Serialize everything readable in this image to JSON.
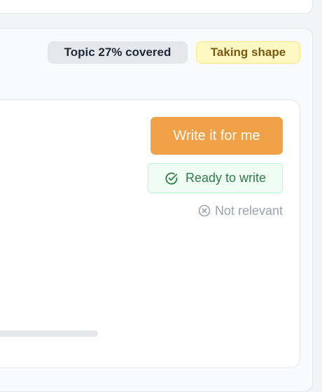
{
  "top_card": {},
  "panel": {
    "coverage_badge": "Topic 27% covered",
    "status_badge": "Taking shape"
  },
  "card": {
    "write_button_label": "Write it for me",
    "ready_label": "Ready to write",
    "not_relevant_label": "Not relevant"
  },
  "icons": {
    "ready": "check-circle-icon",
    "not_relevant": "x-circle-icon"
  },
  "colors": {
    "accent_orange": "#f0a145",
    "ready_green": "#2f7d46",
    "status_yellow_bg": "#fef9c3",
    "status_yellow_text": "#7a5a12"
  }
}
